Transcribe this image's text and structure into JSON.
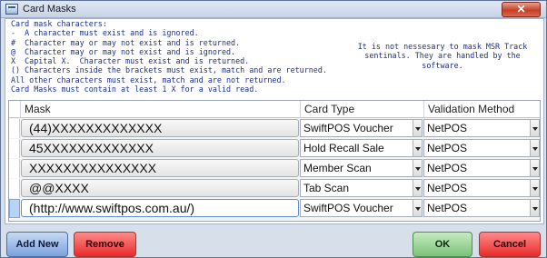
{
  "window": {
    "title": "Card Masks",
    "close_glyph": "✕"
  },
  "help": {
    "text": "Card mask characters:\n-  A character must exist and is ignored.\n#  Character may or may not exist and is returned.\n@  Character may or may not exist and is ignored.\nX  Capital X.  Character must exist and is returned.\n() Characters inside the brackets must exist, match and are returned.\nAll other characters must exist, match and are not returned.\nCard Masks must contain at least 1 X for a valid read.",
    "note": "It is not nessesary to mask MSR Track sentinals. They are handled by the software."
  },
  "grid": {
    "columns": {
      "mask": "Mask",
      "card_type": "Card Type",
      "validation": "Validation Method"
    },
    "rows": [
      {
        "mask": "(44)XXXXXXXXXXXXX",
        "card_type": "SwiftPOS Voucher",
        "validation": "NetPOS"
      },
      {
        "mask": "45XXXXXXXXXXXXX",
        "card_type": "Hold Recall Sale",
        "validation": "NetPOS"
      },
      {
        "mask": "XXXXXXXXXXXXXXX",
        "card_type": "Member Scan",
        "validation": "NetPOS"
      },
      {
        "mask": "@@XXXX",
        "card_type": "Tab Scan",
        "validation": "NetPOS"
      },
      {
        "mask": "(http://www.swiftpos.com.au/)",
        "card_type": "SwiftPOS Voucher",
        "validation": "NetPOS"
      }
    ]
  },
  "buttons": {
    "add_new": "Add New",
    "remove": "Remove",
    "ok": "OK",
    "cancel": "Cancel"
  }
}
